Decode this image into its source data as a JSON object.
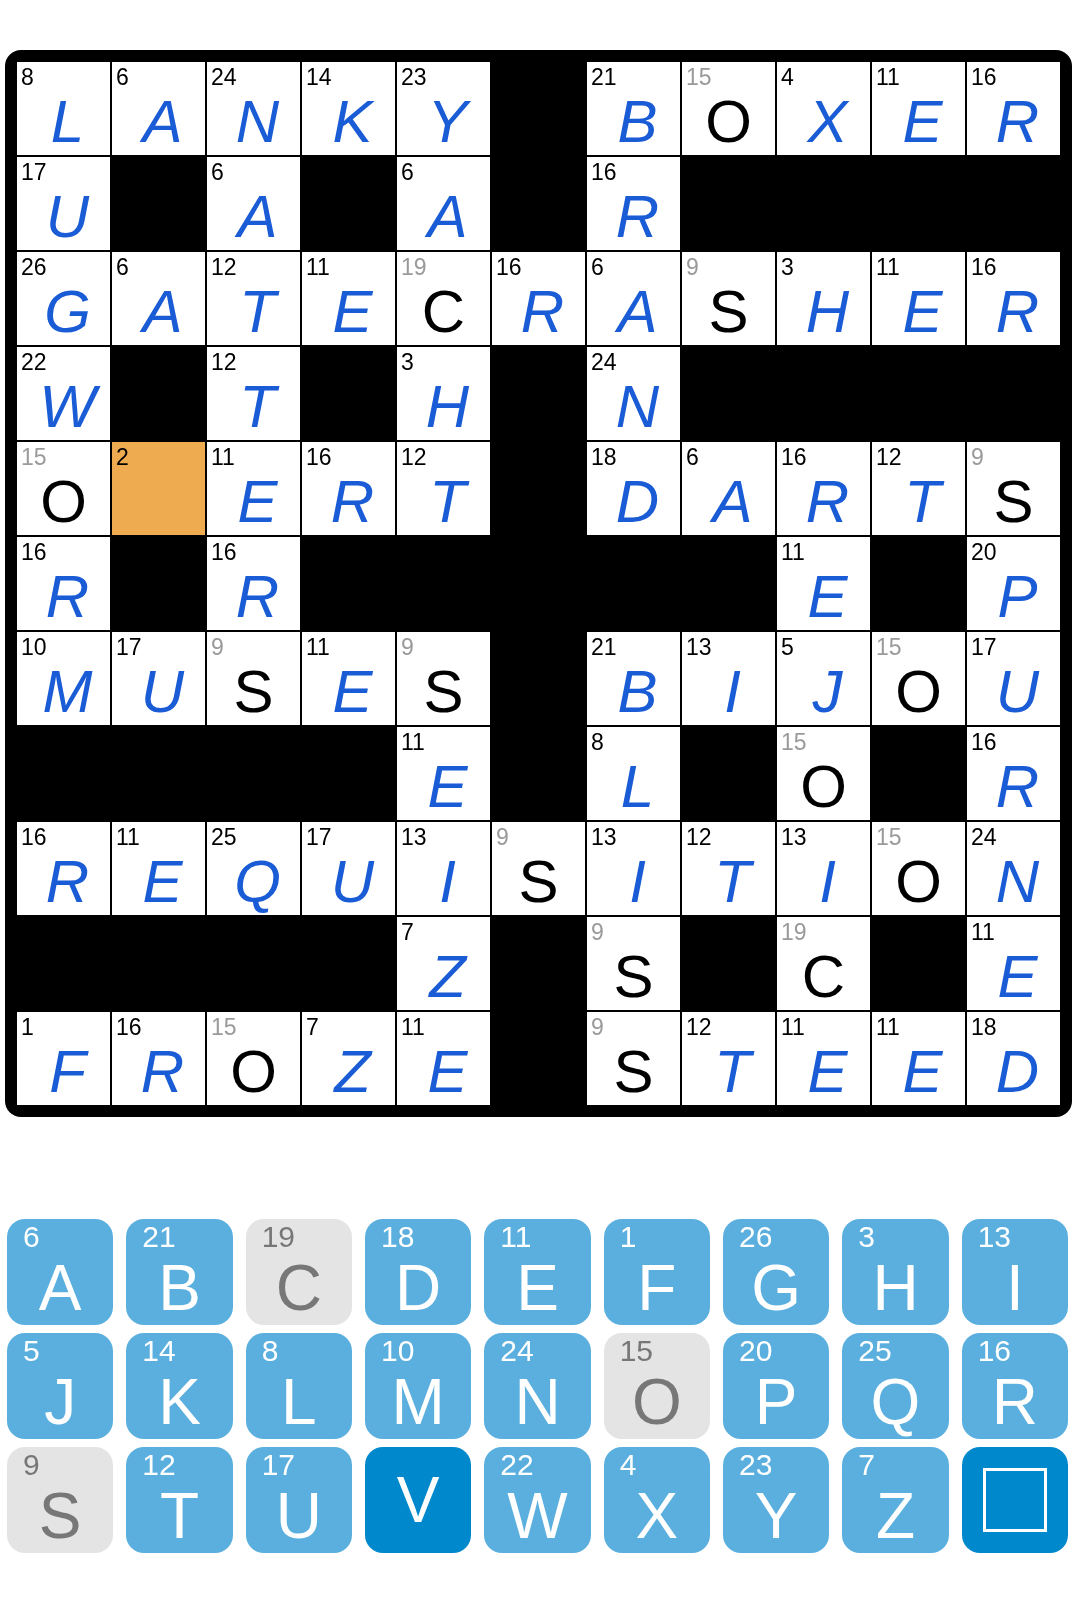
{
  "grid": {
    "rows": [
      [
        {
          "kind": "letter",
          "number": "8",
          "letter": "L",
          "given": false,
          "selected": false
        },
        {
          "kind": "letter",
          "number": "6",
          "letter": "A",
          "given": false,
          "selected": false
        },
        {
          "kind": "letter",
          "number": "24",
          "letter": "N",
          "given": false,
          "selected": false
        },
        {
          "kind": "letter",
          "number": "14",
          "letter": "K",
          "given": false,
          "selected": false
        },
        {
          "kind": "letter",
          "number": "23",
          "letter": "Y",
          "given": false,
          "selected": false
        },
        {
          "kind": "block"
        },
        {
          "kind": "letter",
          "number": "21",
          "letter": "B",
          "given": false,
          "selected": false
        },
        {
          "kind": "letter",
          "number": "15",
          "letter": "O",
          "given": true,
          "selected": false
        },
        {
          "kind": "letter",
          "number": "4",
          "letter": "X",
          "given": false,
          "selected": false
        },
        {
          "kind": "letter",
          "number": "11",
          "letter": "E",
          "given": false,
          "selected": false
        },
        {
          "kind": "letter",
          "number": "16",
          "letter": "R",
          "given": false,
          "selected": false
        }
      ],
      [
        {
          "kind": "letter",
          "number": "17",
          "letter": "U",
          "given": false,
          "selected": false
        },
        {
          "kind": "block"
        },
        {
          "kind": "letter",
          "number": "6",
          "letter": "A",
          "given": false,
          "selected": false
        },
        {
          "kind": "block"
        },
        {
          "kind": "letter",
          "number": "6",
          "letter": "A",
          "given": false,
          "selected": false
        },
        {
          "kind": "block"
        },
        {
          "kind": "letter",
          "number": "16",
          "letter": "R",
          "given": false,
          "selected": false
        },
        {
          "kind": "block"
        },
        {
          "kind": "block"
        },
        {
          "kind": "block"
        },
        {
          "kind": "block"
        }
      ],
      [
        {
          "kind": "letter",
          "number": "26",
          "letter": "G",
          "given": false,
          "selected": false
        },
        {
          "kind": "letter",
          "number": "6",
          "letter": "A",
          "given": false,
          "selected": false
        },
        {
          "kind": "letter",
          "number": "12",
          "letter": "T",
          "given": false,
          "selected": false
        },
        {
          "kind": "letter",
          "number": "11",
          "letter": "E",
          "given": false,
          "selected": false
        },
        {
          "kind": "letter",
          "number": "19",
          "letter": "C",
          "given": true,
          "selected": false
        },
        {
          "kind": "letter",
          "number": "16",
          "letter": "R",
          "given": false,
          "selected": false
        },
        {
          "kind": "letter",
          "number": "6",
          "letter": "A",
          "given": false,
          "selected": false
        },
        {
          "kind": "letter",
          "number": "9",
          "letter": "S",
          "given": true,
          "selected": false
        },
        {
          "kind": "letter",
          "number": "3",
          "letter": "H",
          "given": false,
          "selected": false
        },
        {
          "kind": "letter",
          "number": "11",
          "letter": "E",
          "given": false,
          "selected": false
        },
        {
          "kind": "letter",
          "number": "16",
          "letter": "R",
          "given": false,
          "selected": false
        }
      ],
      [
        {
          "kind": "letter",
          "number": "22",
          "letter": "W",
          "given": false,
          "selected": false
        },
        {
          "kind": "block"
        },
        {
          "kind": "letter",
          "number": "12",
          "letter": "T",
          "given": false,
          "selected": false
        },
        {
          "kind": "block"
        },
        {
          "kind": "letter",
          "number": "3",
          "letter": "H",
          "given": false,
          "selected": false
        },
        {
          "kind": "block"
        },
        {
          "kind": "letter",
          "number": "24",
          "letter": "N",
          "given": false,
          "selected": false
        },
        {
          "kind": "block"
        },
        {
          "kind": "block"
        },
        {
          "kind": "block"
        },
        {
          "kind": "block"
        }
      ],
      [
        {
          "kind": "letter",
          "number": "15",
          "letter": "O",
          "given": true,
          "selected": false
        },
        {
          "kind": "letter",
          "number": "2",
          "given": false,
          "selected": true
        },
        {
          "kind": "letter",
          "number": "11",
          "letter": "E",
          "given": false,
          "selected": false
        },
        {
          "kind": "letter",
          "number": "16",
          "letter": "R",
          "given": false,
          "selected": false
        },
        {
          "kind": "letter",
          "number": "12",
          "letter": "T",
          "given": false,
          "selected": false
        },
        {
          "kind": "block"
        },
        {
          "kind": "letter",
          "number": "18",
          "letter": "D",
          "given": false,
          "selected": false
        },
        {
          "kind": "letter",
          "number": "6",
          "letter": "A",
          "given": false,
          "selected": false
        },
        {
          "kind": "letter",
          "number": "16",
          "letter": "R",
          "given": false,
          "selected": false
        },
        {
          "kind": "letter",
          "number": "12",
          "letter": "T",
          "given": false,
          "selected": false
        },
        {
          "kind": "letter",
          "number": "9",
          "letter": "S",
          "given": true,
          "selected": false
        }
      ],
      [
        {
          "kind": "letter",
          "number": "16",
          "letter": "R",
          "given": false,
          "selected": false
        },
        {
          "kind": "block"
        },
        {
          "kind": "letter",
          "number": "16",
          "letter": "R",
          "given": false,
          "selected": false
        },
        {
          "kind": "block"
        },
        {
          "kind": "block"
        },
        {
          "kind": "block"
        },
        {
          "kind": "block"
        },
        {
          "kind": "block"
        },
        {
          "kind": "letter",
          "number": "11",
          "letter": "E",
          "given": false,
          "selected": false
        },
        {
          "kind": "block"
        },
        {
          "kind": "letter",
          "number": "20",
          "letter": "P",
          "given": false,
          "selected": false
        }
      ],
      [
        {
          "kind": "letter",
          "number": "10",
          "letter": "M",
          "given": false,
          "selected": false
        },
        {
          "kind": "letter",
          "number": "17",
          "letter": "U",
          "given": false,
          "selected": false
        },
        {
          "kind": "letter",
          "number": "9",
          "letter": "S",
          "given": true,
          "selected": false
        },
        {
          "kind": "letter",
          "number": "11",
          "letter": "E",
          "given": false,
          "selected": false
        },
        {
          "kind": "letter",
          "number": "9",
          "letter": "S",
          "given": true,
          "selected": false
        },
        {
          "kind": "block"
        },
        {
          "kind": "letter",
          "number": "21",
          "letter": "B",
          "given": false,
          "selected": false
        },
        {
          "kind": "letter",
          "number": "13",
          "letter": "I",
          "given": false,
          "selected": false
        },
        {
          "kind": "letter",
          "number": "5",
          "letter": "J",
          "given": false,
          "selected": false
        },
        {
          "kind": "letter",
          "number": "15",
          "letter": "O",
          "given": true,
          "selected": false
        },
        {
          "kind": "letter",
          "number": "17",
          "letter": "U",
          "given": false,
          "selected": false
        }
      ],
      [
        {
          "kind": "block"
        },
        {
          "kind": "block"
        },
        {
          "kind": "block"
        },
        {
          "kind": "block"
        },
        {
          "kind": "letter",
          "number": "11",
          "letter": "E",
          "given": false,
          "selected": false
        },
        {
          "kind": "block"
        },
        {
          "kind": "letter",
          "number": "8",
          "letter": "L",
          "given": false,
          "selected": false
        },
        {
          "kind": "block"
        },
        {
          "kind": "letter",
          "number": "15",
          "letter": "O",
          "given": true,
          "selected": false
        },
        {
          "kind": "block"
        },
        {
          "kind": "letter",
          "number": "16",
          "letter": "R",
          "given": false,
          "selected": false
        }
      ],
      [
        {
          "kind": "letter",
          "number": "16",
          "letter": "R",
          "given": false,
          "selected": false
        },
        {
          "kind": "letter",
          "number": "11",
          "letter": "E",
          "given": false,
          "selected": false
        },
        {
          "kind": "letter",
          "number": "25",
          "letter": "Q",
          "given": false,
          "selected": false
        },
        {
          "kind": "letter",
          "number": "17",
          "letter": "U",
          "given": false,
          "selected": false
        },
        {
          "kind": "letter",
          "number": "13",
          "letter": "I",
          "given": false,
          "selected": false
        },
        {
          "kind": "letter",
          "number": "9",
          "letter": "S",
          "given": true,
          "selected": false
        },
        {
          "kind": "letter",
          "number": "13",
          "letter": "I",
          "given": false,
          "selected": false
        },
        {
          "kind": "letter",
          "number": "12",
          "letter": "T",
          "given": false,
          "selected": false
        },
        {
          "kind": "letter",
          "number": "13",
          "letter": "I",
          "given": false,
          "selected": false
        },
        {
          "kind": "letter",
          "number": "15",
          "letter": "O",
          "given": true,
          "selected": false
        },
        {
          "kind": "letter",
          "number": "24",
          "letter": "N",
          "given": false,
          "selected": false
        }
      ],
      [
        {
          "kind": "block"
        },
        {
          "kind": "block"
        },
        {
          "kind": "block"
        },
        {
          "kind": "block"
        },
        {
          "kind": "letter",
          "number": "7",
          "letter": "Z",
          "given": false,
          "selected": false
        },
        {
          "kind": "block"
        },
        {
          "kind": "letter",
          "number": "9",
          "letter": "S",
          "given": true,
          "selected": false
        },
        {
          "kind": "block"
        },
        {
          "kind": "letter",
          "number": "19",
          "letter": "C",
          "given": true,
          "selected": false
        },
        {
          "kind": "block"
        },
        {
          "kind": "letter",
          "number": "11",
          "letter": "E",
          "given": false,
          "selected": false
        }
      ],
      [
        {
          "kind": "letter",
          "number": "1",
          "letter": "F",
          "given": false,
          "selected": false
        },
        {
          "kind": "letter",
          "number": "16",
          "letter": "R",
          "given": false,
          "selected": false
        },
        {
          "kind": "letter",
          "number": "15",
          "letter": "O",
          "given": true,
          "selected": false
        },
        {
          "kind": "letter",
          "number": "7",
          "letter": "Z",
          "given": false,
          "selected": false
        },
        {
          "kind": "letter",
          "number": "11",
          "letter": "E",
          "given": false,
          "selected": false
        },
        {
          "kind": "block"
        },
        {
          "kind": "letter",
          "number": "9",
          "letter": "S",
          "given": true,
          "selected": false
        },
        {
          "kind": "letter",
          "number": "12",
          "letter": "T",
          "given": false,
          "selected": false
        },
        {
          "kind": "letter",
          "number": "11",
          "letter": "E",
          "given": false,
          "selected": false
        },
        {
          "kind": "letter",
          "number": "11",
          "letter": "E",
          "given": false,
          "selected": false
        },
        {
          "kind": "letter",
          "number": "18",
          "letter": "D",
          "given": false,
          "selected": false
        }
      ]
    ]
  },
  "keyboard": {
    "keys": [
      {
        "kind": "letter",
        "number": "6",
        "letter": "A",
        "given": false,
        "highlighted": false
      },
      {
        "kind": "letter",
        "number": "21",
        "letter": "B",
        "given": false,
        "highlighted": false
      },
      {
        "kind": "letter",
        "number": "19",
        "letter": "C",
        "given": true,
        "highlighted": false
      },
      {
        "kind": "letter",
        "number": "18",
        "letter": "D",
        "given": false,
        "highlighted": false
      },
      {
        "kind": "letter",
        "number": "11",
        "letter": "E",
        "given": false,
        "highlighted": false
      },
      {
        "kind": "letter",
        "number": "1",
        "letter": "F",
        "given": false,
        "highlighted": false
      },
      {
        "kind": "letter",
        "number": "26",
        "letter": "G",
        "given": false,
        "highlighted": false
      },
      {
        "kind": "letter",
        "number": "3",
        "letter": "H",
        "given": false,
        "highlighted": false
      },
      {
        "kind": "letter",
        "number": "13",
        "letter": "I",
        "given": false,
        "highlighted": false
      },
      {
        "kind": "letter",
        "number": "5",
        "letter": "J",
        "given": false,
        "highlighted": false
      },
      {
        "kind": "letter",
        "number": "14",
        "letter": "K",
        "given": false,
        "highlighted": false
      },
      {
        "kind": "letter",
        "number": "8",
        "letter": "L",
        "given": false,
        "highlighted": false
      },
      {
        "kind": "letter",
        "number": "10",
        "letter": "M",
        "given": false,
        "highlighted": false
      },
      {
        "kind": "letter",
        "number": "24",
        "letter": "N",
        "given": false,
        "highlighted": false
      },
      {
        "kind": "letter",
        "number": "15",
        "letter": "O",
        "given": true,
        "highlighted": false
      },
      {
        "kind": "letter",
        "number": "20",
        "letter": "P",
        "given": false,
        "highlighted": false
      },
      {
        "kind": "letter",
        "number": "25",
        "letter": "Q",
        "given": false,
        "highlighted": false
      },
      {
        "kind": "letter",
        "number": "16",
        "letter": "R",
        "given": false,
        "highlighted": false
      },
      {
        "kind": "letter",
        "number": "9",
        "letter": "S",
        "given": true,
        "highlighted": false
      },
      {
        "kind": "letter",
        "number": "12",
        "letter": "T",
        "given": false,
        "highlighted": false
      },
      {
        "kind": "letter",
        "number": "17",
        "letter": "U",
        "given": false,
        "highlighted": false
      },
      {
        "kind": "letter",
        "letter": "V",
        "given": false,
        "highlighted": true
      },
      {
        "kind": "letter",
        "number": "22",
        "letter": "W",
        "given": false,
        "highlighted": false
      },
      {
        "kind": "letter",
        "number": "4",
        "letter": "X",
        "given": false,
        "highlighted": false
      },
      {
        "kind": "letter",
        "number": "23",
        "letter": "Y",
        "given": false,
        "highlighted": false
      },
      {
        "kind": "letter",
        "number": "7",
        "letter": "Z",
        "given": false,
        "highlighted": false
      },
      {
        "kind": "square",
        "given": false,
        "highlighted": true
      }
    ]
  }
}
